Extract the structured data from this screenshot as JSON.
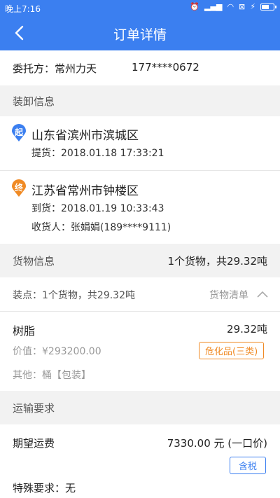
{
  "status_bar": {
    "time": "晚上7:16",
    "icons": [
      "alarm-icon",
      "signal-icon",
      "wifi-icon",
      "sim-icon",
      "charging-icon",
      "battery-icon"
    ]
  },
  "nav": {
    "title": "订单详情",
    "back_icon": "chevron-left-icon"
  },
  "consignor": {
    "label": "委托方：常州力天",
    "phone": "177****0672"
  },
  "loading_section": {
    "title": "装卸信息"
  },
  "origin": {
    "badge": "起",
    "badge_color": "#3b7ff0",
    "address": "山东省滨州市滨城区",
    "pickup": "提货：2018.01.18 17:33:21"
  },
  "destination": {
    "badge": "终",
    "badge_color": "#f08a24",
    "address": "江苏省常州市钟楼区",
    "arrival": "到货：2018.01.19 10:33:43",
    "receiver": "收货人：张娟娟(189****9111)"
  },
  "cargo_section": {
    "title": "货物信息",
    "summary": "1个货物，共29.32吨"
  },
  "loading_point": {
    "text": "装点：1个货物，共29.32吨",
    "list_label": "货物清单",
    "toggle_icon": "chevron-up-icon"
  },
  "cargo_item": {
    "name": "树脂",
    "weight": "29.32吨",
    "value": "价值：¥293200.00",
    "hazard_tag": "危化品(三类)",
    "other": "其他：桶【包装】"
  },
  "transport_section": {
    "title": "运输要求"
  },
  "freight": {
    "label": "期望运费",
    "amount": "7330.00 元 (一口价)",
    "tax_tag": "含税"
  },
  "special": {
    "label": "特殊要求：无"
  },
  "colors": {
    "primary": "#3b7ff0",
    "accent": "#f08a24"
  }
}
